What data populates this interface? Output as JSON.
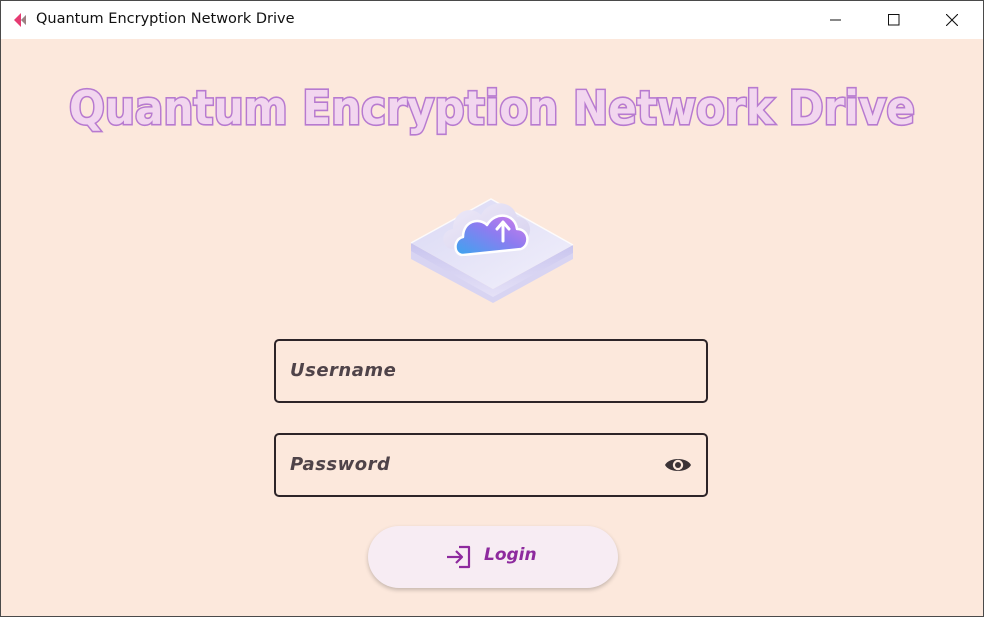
{
  "window": {
    "title": "Quantum Encryption Network Drive",
    "app_icon": "app-logo-icon",
    "controls": {
      "minimize_icon": "minimize-icon",
      "maximize_icon": "maximize-icon",
      "close_icon": "close-icon"
    }
  },
  "main": {
    "heading": "Quantum Encryption Network Drive",
    "illustration": "cloud-upload-icon",
    "username": {
      "placeholder": "Username",
      "value": ""
    },
    "password": {
      "placeholder": "Password",
      "value": "",
      "visibility_icon": "eye-icon"
    },
    "login_button": {
      "label": "Login",
      "icon": "login-icon"
    }
  },
  "colors": {
    "background": "#fce8dc",
    "heading_fill": "#f2d6ef",
    "heading_outline": "#b77ad0",
    "field_border": "#2d2428",
    "field_label": "#4f4349",
    "button_background": "#f7ecf3",
    "button_text": "#8e2a9e"
  }
}
